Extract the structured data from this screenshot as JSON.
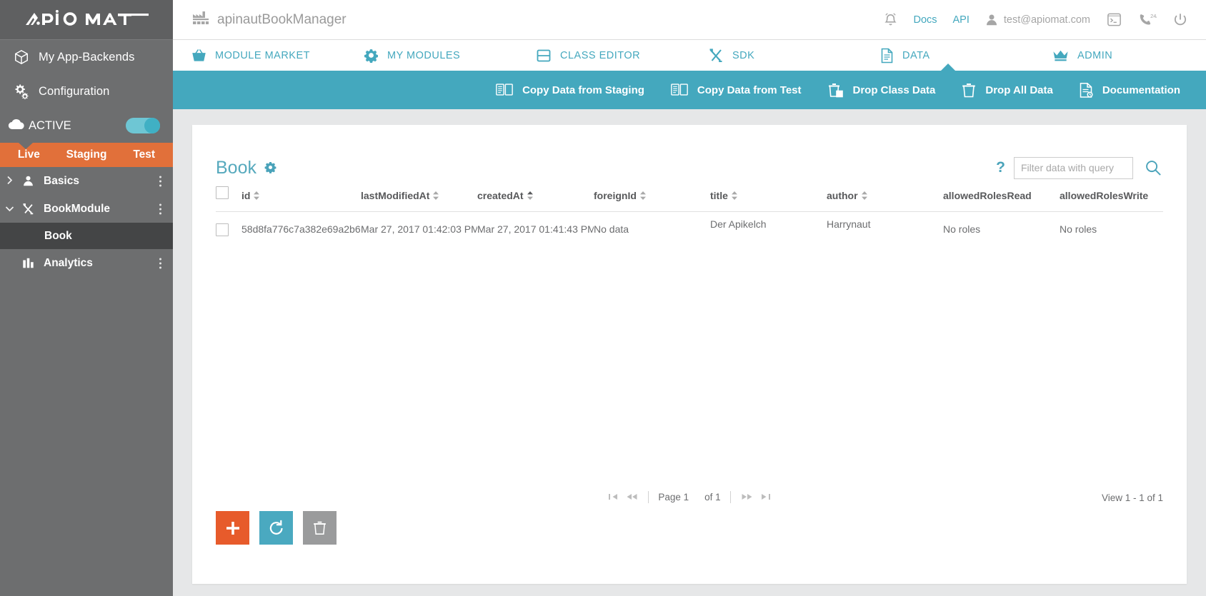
{
  "sidebar": {
    "logo_text": "APIOMAT",
    "links": [
      {
        "label": "My App-Backends",
        "icon": "cube-icon"
      },
      {
        "label": "Configuration",
        "icon": "gears-icon"
      }
    ],
    "active": {
      "label": "ACTIVE",
      "icon": "cloud-icon",
      "toggle_on": true
    },
    "environments": [
      {
        "label": "Live",
        "selected": true
      },
      {
        "label": "Staging",
        "selected": false
      },
      {
        "label": "Test",
        "selected": false
      }
    ],
    "tree": [
      {
        "label": "Basics",
        "icon": "person-icon",
        "caret": "›",
        "expanded": false
      },
      {
        "label": "BookModule",
        "icon": "tools-icon",
        "caret": "⌄",
        "expanded": true
      }
    ],
    "tree_child": {
      "label": "Book",
      "selected": true
    },
    "analytics": {
      "label": "Analytics",
      "icon": "bars-icon"
    }
  },
  "topbar": {
    "app_name": "apinautBookManager",
    "app_icon": "factory-icon",
    "bell_icon": "bell-icon",
    "docs_label": "Docs",
    "api_label": "API",
    "user_icon": "person-icon",
    "user_email": "test@apiomat.com",
    "console_icon": "terminal-icon",
    "support_icon": "phone-247-icon",
    "power_icon": "power-icon"
  },
  "nav": {
    "items": [
      {
        "label": "MODULE MARKET",
        "icon": "basket-icon",
        "active": false
      },
      {
        "label": "MY MODULES",
        "icon": "gear-icon",
        "active": false
      },
      {
        "label": "CLASS EDITOR",
        "icon": "class-icon",
        "active": false
      },
      {
        "label": "SDK",
        "icon": "tools-icon",
        "active": false
      },
      {
        "label": "DATA",
        "icon": "document-icon",
        "active": true
      },
      {
        "label": "ADMIN",
        "icon": "crown-icon",
        "active": false
      }
    ]
  },
  "subbar": {
    "items": [
      {
        "label": "Copy Data from Staging",
        "icon": "copy-data-icon"
      },
      {
        "label": "Copy Data from Test",
        "icon": "copy-data-icon"
      },
      {
        "label": "Drop Class Data",
        "icon": "trash-class-icon"
      },
      {
        "label": "Drop All Data",
        "icon": "trash-icon"
      },
      {
        "label": "Documentation",
        "icon": "doc-clock-icon"
      }
    ]
  },
  "panel": {
    "title": "Book",
    "title_gear_icon": "gear-icon",
    "help_mark": "?",
    "filter_placeholder": "Filter data with query",
    "filter_value": "",
    "search_icon": "search-icon",
    "columns": [
      {
        "key": "checkbox",
        "label": "",
        "sortable": false
      },
      {
        "key": "id",
        "label": "id",
        "sortable": true
      },
      {
        "key": "lastModifiedAt",
        "label": "lastModifiedAt",
        "sortable": true
      },
      {
        "key": "createdAt",
        "label": "createdAt",
        "sortable": true
      },
      {
        "key": "foreignId",
        "label": "foreignId",
        "sortable": true
      },
      {
        "key": "title",
        "label": "title",
        "sortable": true
      },
      {
        "key": "author",
        "label": "author",
        "sortable": true
      },
      {
        "key": "allowedRolesRead",
        "label": "allowedRolesRead",
        "sortable": false
      },
      {
        "key": "allowedRolesWrite",
        "label": "allowedRolesWrite",
        "sortable": false
      }
    ],
    "rows": [
      {
        "id": "58d8fa776c7a382e69a2b6(",
        "lastModifiedAt": "Mar 27, 2017 01:42:03 PM",
        "createdAt": "Mar 27, 2017 01:41:43 PM",
        "foreignId": "No data",
        "title": "Der Apikelch",
        "author": "Harrynaut",
        "allowedRolesRead": "No roles",
        "allowedRolesWrite": "No roles"
      }
    ],
    "pager": {
      "first_icon": "◀|",
      "prev_icon": "◀◀",
      "page_label": "Page 1",
      "of_label": "of 1",
      "next_icon": "▶▶",
      "last_icon": "|▶"
    },
    "view_count": "View 1 - 1 of 1",
    "actions": [
      {
        "name": "add",
        "glyph": "+",
        "color": "#e75b2b"
      },
      {
        "name": "refresh",
        "glyph": "↻",
        "color": "#4aa9c0"
      },
      {
        "name": "delete",
        "glyph": "trash",
        "color": "#9a9b9c"
      }
    ]
  },
  "colors": {
    "accent_teal": "#44a8be",
    "accent_orange": "#e1703a",
    "sidebar_bg": "#6d6e6f",
    "content_bg": "#e6e7e8"
  }
}
